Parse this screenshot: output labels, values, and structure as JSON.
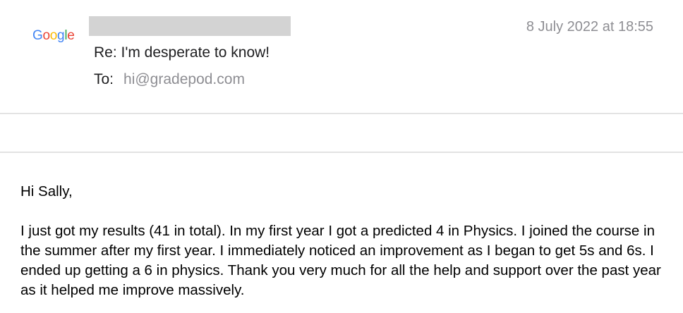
{
  "header": {
    "logo_letters": [
      {
        "char": "G",
        "color": "#4285F4"
      },
      {
        "char": "o",
        "color": "#EA4335"
      },
      {
        "char": "o",
        "color": "#FBBC05"
      },
      {
        "char": "g",
        "color": "#4285F4"
      },
      {
        "char": "l",
        "color": "#34A853"
      },
      {
        "char": "e",
        "color": "#EA4335"
      }
    ],
    "date": "8 July 2022 at 18:55",
    "subject": "Re: I'm desperate to know!",
    "to_label": "To:",
    "to_value": "hi@gradepod.com"
  },
  "body": {
    "greeting": "Hi Sally,",
    "message": "I just got my results (41 in total). In my first year I got a predicted 4 in Physics. I joined the course in the summer after my first year. I immediately noticed an improvement as I began to get 5s and 6s. I ended up getting a 6 in physics. Thank you very much for all the help and support over the past year as it helped me improve massively."
  }
}
